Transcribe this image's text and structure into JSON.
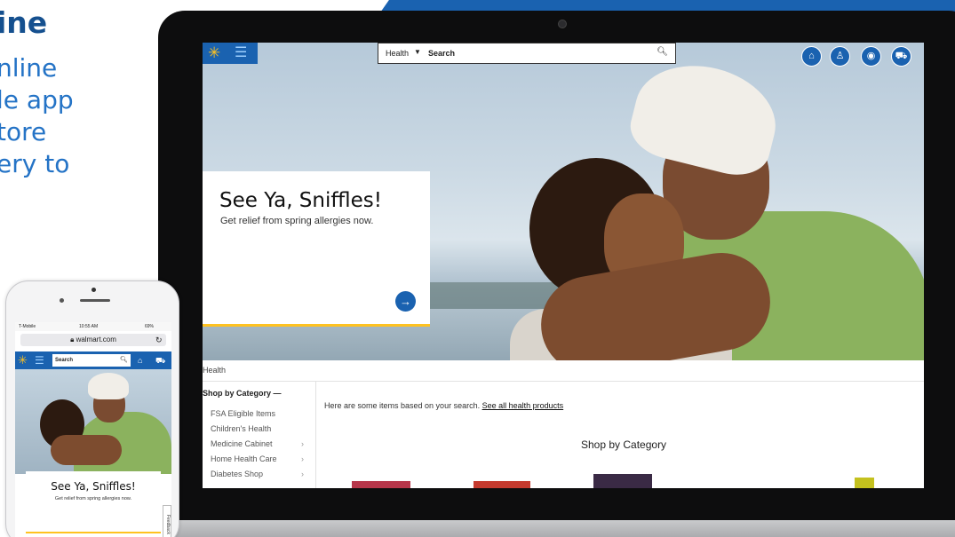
{
  "marketing": {
    "heading": "ine",
    "lines": [
      "nline",
      "le app",
      "tore",
      "ery to"
    ]
  },
  "desktop": {
    "search": {
      "department": "Health",
      "placeholder": "Search"
    },
    "hero": {
      "title": "See Ya, Sniffles!",
      "subtitle": "Get relief from spring allergies now.",
      "arrow_icon": "arrow-right-icon"
    },
    "breadcrumb": "Health",
    "sidebar": {
      "title": "Shop by Category —",
      "items": [
        {
          "label": "FSA Eligible Items",
          "chevron": ""
        },
        {
          "label": "Children's Health",
          "chevron": ""
        },
        {
          "label": "Medicine Cabinet",
          "chevron": "›"
        },
        {
          "label": "Home Health Care",
          "chevron": "›"
        },
        {
          "label": "Diabetes Shop",
          "chevron": "›"
        }
      ]
    },
    "results_text": "Here are some items based on your search. ",
    "results_link": "See all health products",
    "category_heading": "Shop by Category"
  },
  "phone": {
    "carrier": "T-Mobile",
    "time": "10:55 AM",
    "battery": "69%",
    "url": "walmart.com",
    "search_placeholder": "Search",
    "hero_title": "See Ya, Sniffles!",
    "hero_subtitle": "Get relief from spring allergies now.",
    "feedback": "Feedback"
  },
  "colors": {
    "walmart_blue": "#1a62b0",
    "spark_yellow": "#ffc220",
    "copy_blue": "#2473c6"
  }
}
